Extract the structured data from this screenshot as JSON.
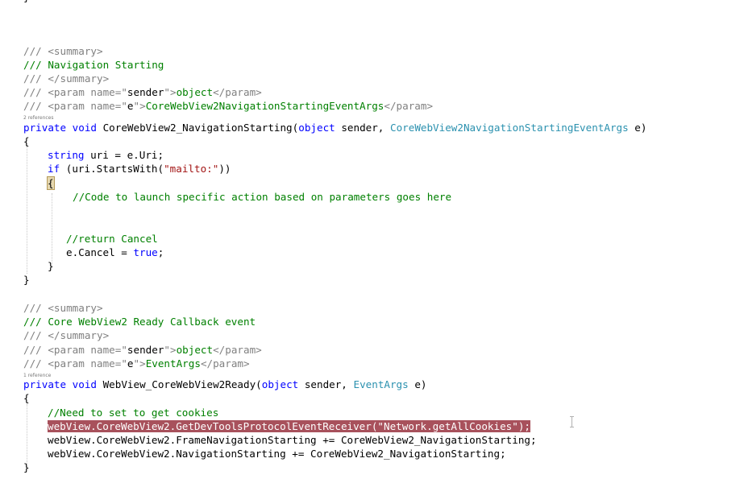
{
  "editor": {
    "top_fragment": "}",
    "codelens_1": "2 references",
    "codelens_2": "1 reference",
    "lines": {
      "l01_a": "/// ",
      "l01_b": "<summary>",
      "l02_a": "/// Navigation Starting",
      "l03_a": "/// ",
      "l03_b": "</summary>",
      "l04_a": "/// ",
      "l04_b": "<param name=\"",
      "l04_c": "sender",
      "l04_d": "\">",
      "l04_e": "object",
      "l04_f": "</param>",
      "l05_a": "/// ",
      "l05_b": "<param name=\"",
      "l05_c": "e",
      "l05_d": "\">",
      "l05_e": "CoreWebView2NavigationStartingEventArgs",
      "l05_f": "</param>",
      "l06_a": "private",
      "l06_b": " ",
      "l06_c": "void",
      "l06_d": " CoreWebView2_NavigationStarting(",
      "l06_e": "object",
      "l06_f": " sender, ",
      "l06_g": "CoreWebView2NavigationStartingEventArgs",
      "l06_h": " e)",
      "l07_a": "{",
      "l08_a": "string",
      "l08_b": " uri = e.Uri;",
      "l09_a": "if",
      "l09_b": " (uri.StartsWith(",
      "l09_c": "\"mailto:\"",
      "l09_d": "))",
      "l10_a": "{",
      "l11_a": "//Code to launch specific action based on parameters goes here",
      "l12_a": "//return Cancel",
      "l13_a": "e.Cancel = ",
      "l13_b": "true",
      "l13_c": ";",
      "l14_a": "}",
      "l15_a": "}",
      "l16_a": "/// ",
      "l16_b": "<summary>",
      "l17_a": "/// Core WebView2 Ready Callback event",
      "l18_a": "/// ",
      "l18_b": "</summary>",
      "l19_a": "/// ",
      "l19_b": "<param name=\"",
      "l19_c": "sender",
      "l19_d": "\">",
      "l19_e": "object",
      "l19_f": "</param>",
      "l20_a": "/// ",
      "l20_b": "<param name=\"",
      "l20_c": "e",
      "l20_d": "\">",
      "l20_e": "EventArgs",
      "l20_f": "</param>",
      "l21_a": "private",
      "l21_b": " ",
      "l21_c": "void",
      "l21_d": " WebView_CoreWebView2Ready(",
      "l21_e": "object",
      "l21_f": " sender, ",
      "l21_g": "EventArgs",
      "l21_h": " e)",
      "l22_a": "{",
      "l23_a": "//Need to set to get cookies",
      "l24_a": "webView.CoreWebView2.GetDevToolsProtocolEventReceiver(\"Network.getAllCookies\");",
      "l25_a": "webView.CoreWebView2.FrameNavigationStarting += CoreWebView2_NavigationStarting;",
      "l26_a": "webView.CoreWebView2.NavigationStarting += CoreWebView2_NavigationStarting;",
      "l27_a": "}"
    }
  },
  "colors": {
    "comment": "#008000",
    "doc_tag": "#808080",
    "keyword": "#0000ff",
    "type": "#2b91af",
    "string": "#a31515",
    "selection_highlight": "#a8515c"
  }
}
